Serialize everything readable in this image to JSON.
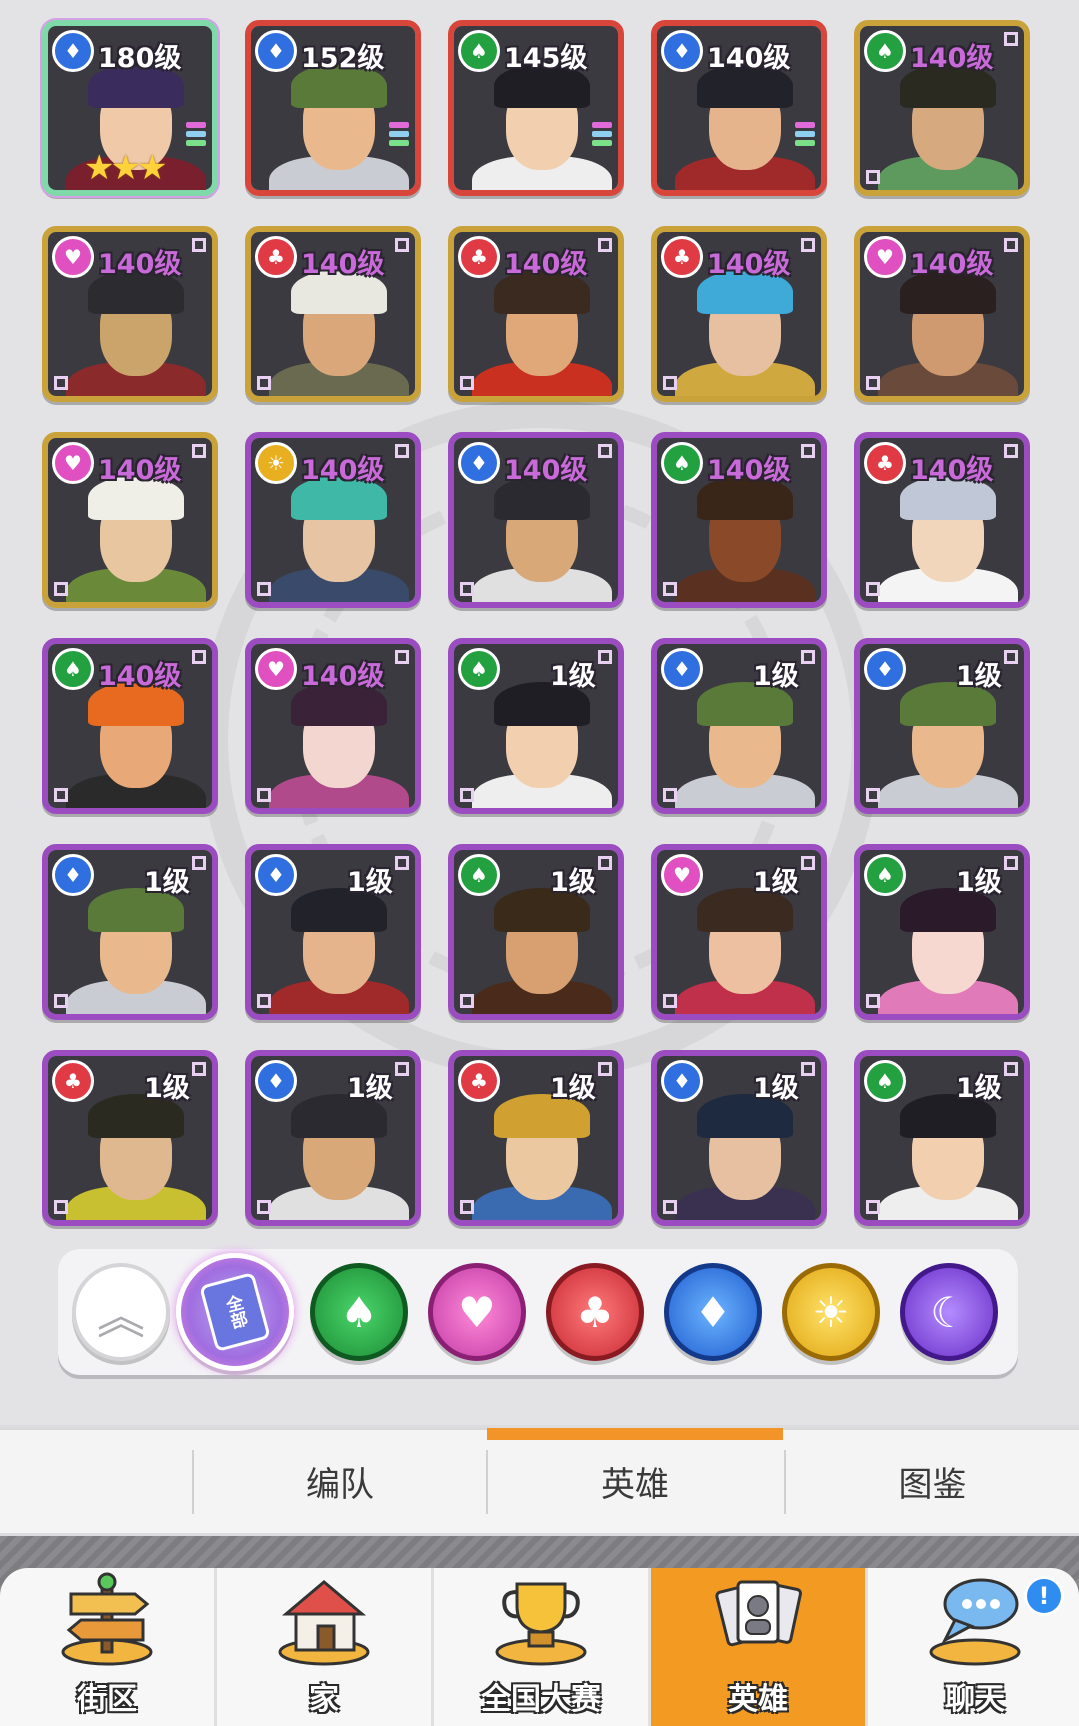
{
  "heroes": [
    {
      "level": "180级",
      "faction": "blue",
      "border": "rainbow",
      "stars": "★★★",
      "hair": "#3a2d5e",
      "skin": "#f0c9a8",
      "outfit": "#7a1f2e"
    },
    {
      "level": "152级",
      "faction": "blue",
      "border": "red",
      "hair": "#5a7a3a",
      "skin": "#e9b98d",
      "outfit": "#c9ccd2"
    },
    {
      "level": "145级",
      "faction": "green",
      "border": "red",
      "hair": "#1e1e24",
      "skin": "#f2cfae",
      "outfit": "#eeeeee"
    },
    {
      "level": "140级",
      "faction": "blue",
      "border": "red",
      "hair": "#22222b",
      "skin": "#e6b48c",
      "outfit": "#a02a2a"
    },
    {
      "level": "140级",
      "faction": "green",
      "border": "gold",
      "hair": "#2a2a20",
      "skin": "#d7a97e",
      "outfit": "#5e9a5e"
    },
    {
      "level": "140级",
      "faction": "pink",
      "border": "gold",
      "hair": "#2c2c30",
      "skin": "#caa46a",
      "outfit": "#8a2a2a"
    },
    {
      "level": "140级",
      "faction": "red",
      "border": "gold",
      "hair": "#e8e8e0",
      "skin": "#d9a77a",
      "outfit": "#6a6a50"
    },
    {
      "level": "140级",
      "faction": "red",
      "border": "gold",
      "hair": "#3a2a20",
      "skin": "#e0a878",
      "outfit": "#c9301f"
    },
    {
      "level": "140级",
      "faction": "red",
      "border": "gold",
      "hair": "#3fa9d8",
      "skin": "#e6c0a0",
      "outfit": "#d0a840"
    },
    {
      "level": "140级",
      "faction": "pink",
      "border": "gold",
      "hair": "#2a2020",
      "skin": "#d09a70",
      "outfit": "#6a4a3a"
    },
    {
      "level": "140级",
      "faction": "pink",
      "border": "gold",
      "hair": "#efefe8",
      "skin": "#e8c6a0",
      "outfit": "#6a8a3a"
    },
    {
      "level": "140级",
      "faction": "yellow",
      "border": "purple",
      "hair": "#3fb8a8",
      "skin": "#e6c4a4",
      "outfit": "#3a4a6a"
    },
    {
      "level": "140级",
      "faction": "blue",
      "border": "purple",
      "hair": "#2a2a30",
      "skin": "#d8a878",
      "outfit": "#e0e0e0"
    },
    {
      "level": "140级",
      "faction": "green",
      "border": "purple",
      "hair": "#3a2618",
      "skin": "#8a4a2a",
      "outfit": "#5a3020"
    },
    {
      "level": "140级",
      "faction": "red",
      "border": "purple",
      "hair": "#c0c8d8",
      "skin": "#f2d6bc",
      "outfit": "#f4f4f4"
    },
    {
      "level": "140级",
      "faction": "green",
      "border": "purple",
      "hair": "#e86a20",
      "skin": "#e8a878",
      "outfit": "#2a2a2a"
    },
    {
      "level": "140级",
      "faction": "pink",
      "border": "purple",
      "hair": "#3a2238",
      "skin": "#f4d6d0",
      "outfit": "#b04a8a"
    },
    {
      "level": "1级",
      "faction": "green",
      "border": "purple",
      "hair": "#1e1e24",
      "skin": "#f2cfae",
      "outfit": "#eeeeee"
    },
    {
      "level": "1级",
      "faction": "blue",
      "border": "purple",
      "hair": "#5a7a3a",
      "skin": "#e9b98d",
      "outfit": "#c9ccd2"
    },
    {
      "level": "1级",
      "faction": "blue",
      "border": "purple",
      "hair": "#5a7a3a",
      "skin": "#e9b98d",
      "outfit": "#c9ccd2"
    },
    {
      "level": "1级",
      "faction": "blue",
      "border": "purple",
      "hair": "#5a7a3a",
      "skin": "#e9b98d",
      "outfit": "#c9ccd2"
    },
    {
      "level": "1级",
      "faction": "blue",
      "border": "purple",
      "hair": "#22222b",
      "skin": "#e6b48c",
      "outfit": "#a02a2a"
    },
    {
      "level": "1级",
      "faction": "green",
      "border": "purple",
      "hair": "#3a2a1a",
      "skin": "#d8a070",
      "outfit": "#4a2a1a"
    },
    {
      "level": "1级",
      "faction": "pink",
      "border": "purple",
      "hair": "#3a2a20",
      "skin": "#ecc0a0",
      "outfit": "#c0304a"
    },
    {
      "level": "1级",
      "faction": "green",
      "border": "purple",
      "hair": "#2a1a2a",
      "skin": "#f6d8d0",
      "outfit": "#e07ab8"
    },
    {
      "level": "1级",
      "faction": "red",
      "border": "purple",
      "hair": "#2a2a20",
      "skin": "#e0b890",
      "outfit": "#c8c030"
    },
    {
      "level": "1级",
      "faction": "blue",
      "border": "purple",
      "hair": "#2a2a30",
      "skin": "#d8a878",
      "outfit": "#e0e0e0"
    },
    {
      "level": "1级",
      "faction": "red",
      "border": "purple",
      "hair": "#d0a030",
      "skin": "#ecc8a0",
      "outfit": "#3a6ab0"
    },
    {
      "level": "1级",
      "faction": "blue",
      "border": "purple",
      "hair": "#1e2a40",
      "skin": "#e6c0a0",
      "outfit": "#3a3050"
    },
    {
      "level": "1级",
      "faction": "green",
      "border": "purple",
      "hair": "#1e1e24",
      "skin": "#f2cfae",
      "outfit": "#eeeeee"
    }
  ],
  "faction_colors": {
    "blue": "#2f6fe0",
    "green": "#23a040",
    "pink": "#e050c0",
    "red": "#e03a44",
    "yellow": "#e8b020",
    "purple": "#7a3ad8"
  },
  "faction_icons": {
    "blue": "diamond-icon",
    "green": "spade-icon",
    "pink": "heart-icon",
    "red": "club-icon",
    "yellow": "sun-icon",
    "purple": "moon-icon"
  },
  "filter": {
    "all_label": "全部",
    "buttons": [
      {
        "icon": "collapse-up-icon",
        "color": "#ffffff"
      },
      {
        "icon": "all-cards-icon",
        "color": "#a06ee0"
      },
      {
        "icon": "spade-icon",
        "color": "#23a040"
      },
      {
        "icon": "heart-icon",
        "color": "#e050c0"
      },
      {
        "icon": "club-icon",
        "color": "#e03a44"
      },
      {
        "icon": "diamond-icon",
        "color": "#2f6fe0"
      },
      {
        "icon": "sun-icon",
        "color": "#e8b020"
      },
      {
        "icon": "moon-icon",
        "color": "#7a3ad8"
      }
    ]
  },
  "tabs": {
    "formation": "编队",
    "heroes": "英雄",
    "collection": "图鉴",
    "active": "heroes"
  },
  "nav": {
    "items": [
      {
        "label": "街区",
        "icon": "signpost-icon"
      },
      {
        "label": "家",
        "icon": "house-icon"
      },
      {
        "label": "全国大赛",
        "icon": "trophy-icon"
      },
      {
        "label": "英雄",
        "icon": "hero-cards-icon",
        "active": true
      },
      {
        "label": "聊天",
        "icon": "chat-bubble-icon",
        "badge": "!"
      }
    ]
  }
}
